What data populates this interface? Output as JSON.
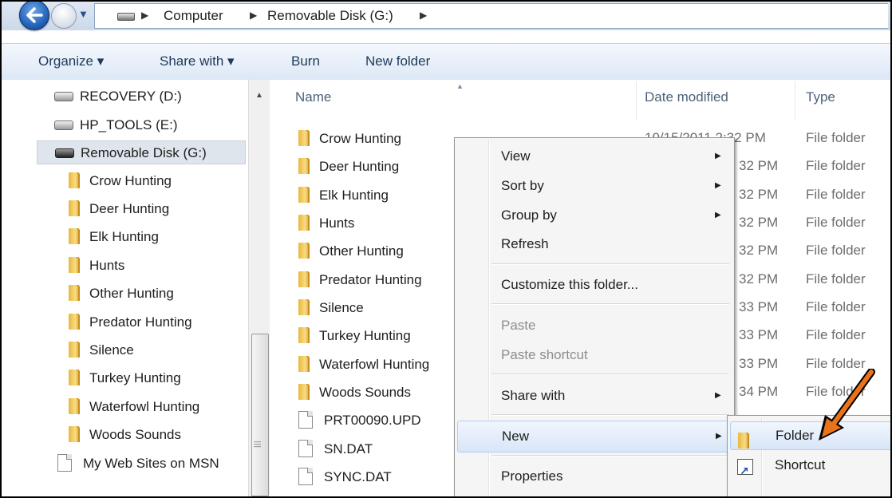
{
  "address": {
    "crumbs": [
      "Computer",
      "Removable Disk (G:)"
    ]
  },
  "toolbar": {
    "organize": "Organize ▾",
    "share_with": "Share with ▾",
    "burn": "Burn",
    "new_folder": "New folder"
  },
  "nav": {
    "drives": [
      {
        "label": "RECOVERY (D:)"
      },
      {
        "label": "HP_TOOLS (E:)"
      },
      {
        "label": "Removable Disk (G:)"
      }
    ],
    "folders": [
      "Crow Hunting",
      "Deer Hunting",
      "Elk Hunting",
      "Hunts",
      "Other Hunting",
      "Predator Hunting",
      "Silence",
      "Turkey Hunting",
      "Waterfowl Hunting",
      "Woods Sounds"
    ],
    "web": "My Web Sites on MSN"
  },
  "columns": {
    "name": "Name",
    "date": "Date modified",
    "type": "Type"
  },
  "files": [
    {
      "name": "Crow Hunting",
      "date": "10/15/2011 2:32 PM",
      "type": "File folder"
    },
    {
      "name": "Deer Hunting",
      "date": "32 PM",
      "type": "File folder"
    },
    {
      "name": "Elk Hunting",
      "date": "32 PM",
      "type": "File folder"
    },
    {
      "name": "Hunts",
      "date": "32 PM",
      "type": "File folder"
    },
    {
      "name": "Other Hunting",
      "date": "32 PM",
      "type": "File folder"
    },
    {
      "name": "Predator Hunting",
      "date": "32 PM",
      "type": "File folder"
    },
    {
      "name": "Silence",
      "date": "33 PM",
      "type": "File folder"
    },
    {
      "name": "Turkey Hunting",
      "date": "33 PM",
      "type": "File folder"
    },
    {
      "name": "Waterfowl Hunting",
      "date": "33 PM",
      "type": "File folder"
    },
    {
      "name": "Woods Sounds",
      "date": "34 PM",
      "type": "File folder"
    },
    {
      "name": "PRT00090.UPD"
    },
    {
      "name": "SN.DAT"
    },
    {
      "name": "SYNC.DAT"
    }
  ],
  "context_menu": {
    "view": "View",
    "sort_by": "Sort by",
    "group_by": "Group by",
    "refresh": "Refresh",
    "customize": "Customize this folder...",
    "paste": "Paste",
    "paste_shortcut": "Paste shortcut",
    "share_with": "Share with",
    "new": "New",
    "properties": "Properties"
  },
  "submenu": {
    "folder": "Folder",
    "shortcut": "Shortcut"
  },
  "colors": {
    "accent": "#1e395b",
    "highlight": "#d8e6f8",
    "annotation_arrow": "#e8731a"
  }
}
